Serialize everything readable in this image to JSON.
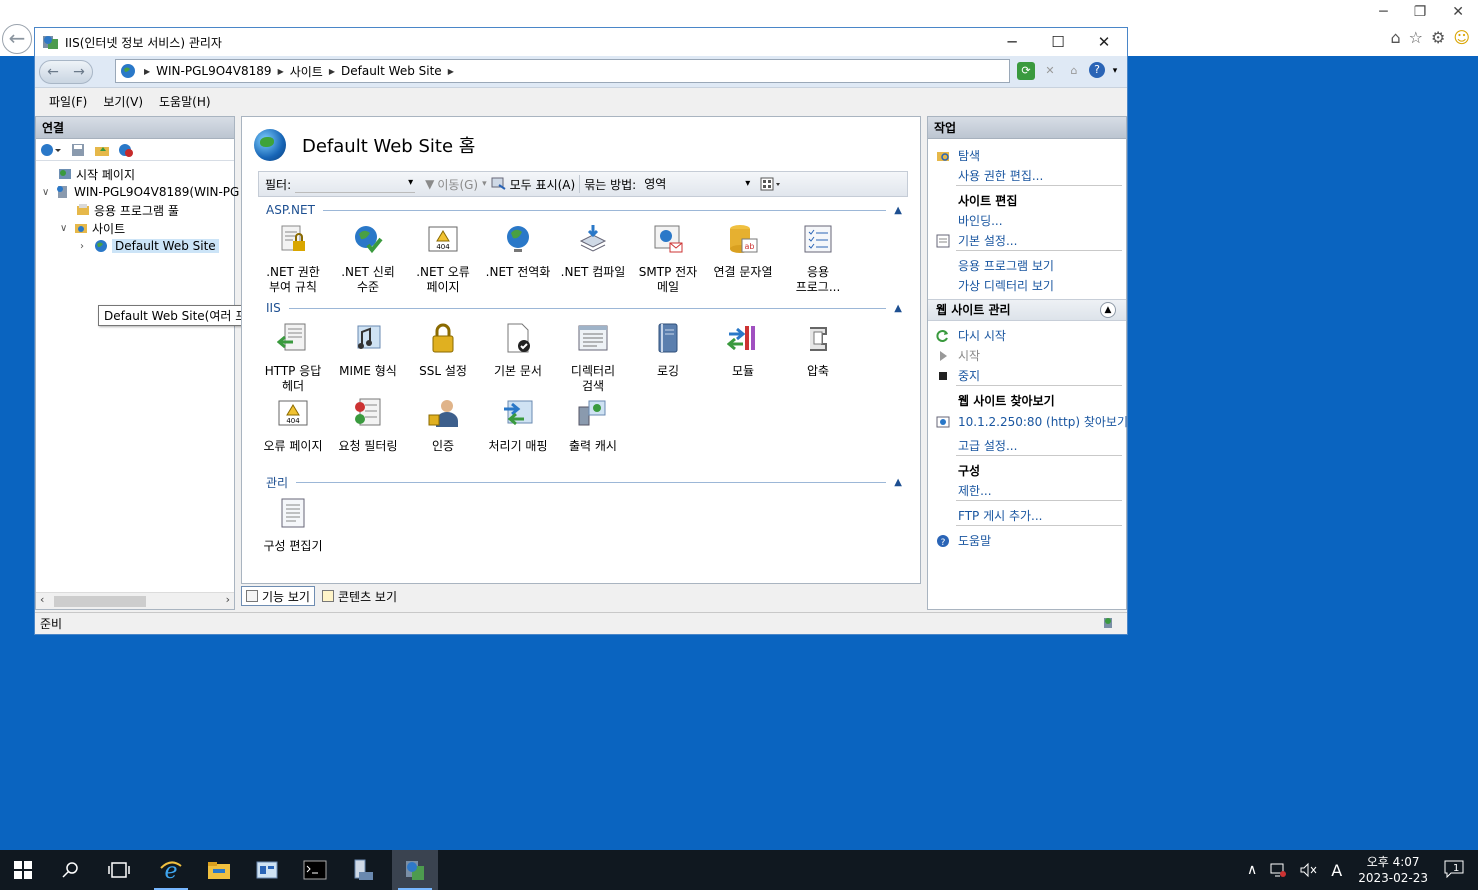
{
  "window": {
    "title": "IIS(인터넷 정보 서비스) 관리자",
    "controls": {
      "minimize": "─",
      "maximize": "☐",
      "close": "✕"
    }
  },
  "address": {
    "crumbs": [
      "WIN-PGL9O4V8189",
      "사이트",
      "Default Web Site"
    ]
  },
  "menu": [
    "파일(F)",
    "보기(V)",
    "도움말(H)"
  ],
  "connections": {
    "header": "연결",
    "tree": [
      {
        "label": "시작 페이지"
      },
      {
        "label": "WIN-PGL9O4V8189(WIN-PG"
      },
      {
        "label": "응용 프로그램 풀"
      },
      {
        "label": "사이트"
      },
      {
        "label": "Default Web Site"
      }
    ],
    "tooltip": "Default Web Site(여러 프로토콜)"
  },
  "center": {
    "title": "Default Web Site 홈",
    "filter": {
      "label": "필터:",
      "go": "이동(G)",
      "show_all": "모두 표시(A)",
      "group_label": "묶는 방법:",
      "group_value": "영역"
    },
    "sections": [
      {
        "name": "ASP.NET",
        "features": [
          {
            "l1": ".NET 권한",
            "l2": "부여 규칙"
          },
          {
            "l1": ".NET 신뢰",
            "l2": "수준"
          },
          {
            "l1": ".NET 오류",
            "l2": "페이지"
          },
          {
            "l1": ".NET 전역화",
            "l2": ""
          },
          {
            "l1": ".NET 컴파일",
            "l2": ""
          },
          {
            "l1": "SMTP 전자",
            "l2": "메일"
          },
          {
            "l1": "연결 문자열",
            "l2": ""
          },
          {
            "l1": "응용",
            "l2": "프로그..."
          }
        ]
      },
      {
        "name": "IIS",
        "features": [
          {
            "l1": "HTTP 응답",
            "l2": "헤더"
          },
          {
            "l1": "MIME 형식",
            "l2": ""
          },
          {
            "l1": "SSL 설정",
            "l2": ""
          },
          {
            "l1": "기본 문서",
            "l2": ""
          },
          {
            "l1": "디렉터리",
            "l2": "검색"
          },
          {
            "l1": "로깅",
            "l2": ""
          },
          {
            "l1": "모듈",
            "l2": ""
          },
          {
            "l1": "압축",
            "l2": ""
          },
          {
            "l1": "오류 페이지",
            "l2": ""
          },
          {
            "l1": "요청 필터링",
            "l2": ""
          },
          {
            "l1": "인증",
            "l2": ""
          },
          {
            "l1": "처리기 매핑",
            "l2": ""
          },
          {
            "l1": "출력 캐시",
            "l2": ""
          }
        ]
      },
      {
        "name": "관리",
        "features": [
          {
            "l1": "구성 편집기",
            "l2": ""
          }
        ]
      }
    ],
    "view_tabs": [
      "기능 보기",
      "콘텐츠 보기"
    ]
  },
  "actions": {
    "header": "작업",
    "explore": "탐색",
    "edit_permissions": "사용 권한 편집...",
    "edit_site_hdr": "사이트 편집",
    "bindings": "바인딩...",
    "basic_settings": "기본 설정...",
    "view_apps": "응용 프로그램 보기",
    "view_vdirs": "가상 디렉터리 보기",
    "manage_hdr": "웹 사이트 관리",
    "restart": "다시 시작",
    "start": "시작",
    "stop": "중지",
    "browse_hdr": "웹 사이트 찾아보기",
    "browse_link": "10.1.2.250:80 (http) 찾아보기",
    "advanced": "고급 설정...",
    "config_hdr": "구성",
    "limits": "제한...",
    "ftp": "FTP 게시 추가...",
    "help": "도움말"
  },
  "status": {
    "text": "준비"
  },
  "taskbar": {
    "time": "오후 4:07",
    "date": "2023-02-23",
    "ime": "A",
    "notifications": "1"
  },
  "colors": {
    "desktop": "#0a64c0",
    "link": "#1a56a0",
    "section": "#1d4f91"
  }
}
